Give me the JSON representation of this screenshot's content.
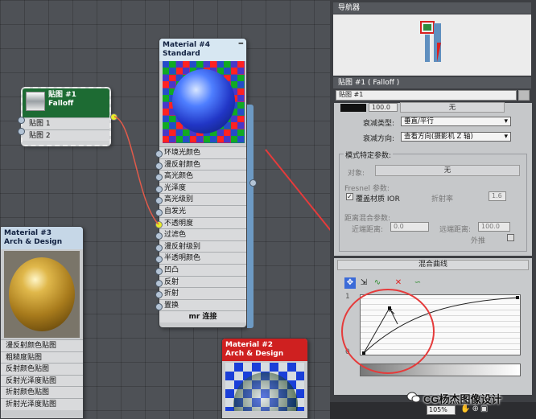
{
  "falloff_node": {
    "title_line1": "贴图 #1",
    "title_line2": "Falloff",
    "slots": [
      "贴图 1",
      "贴图 2"
    ]
  },
  "material4": {
    "title_line1": "Material #4",
    "title_line2": "Standard",
    "slots": [
      "环境光颜色",
      "漫反射颜色",
      "高光颜色",
      "光泽度",
      "高光级别",
      "自发光",
      "不透明度",
      "过滤色",
      "漫反射级别",
      "半透明颜色",
      "凹凸",
      "反射",
      "折射",
      "置换"
    ],
    "footer": "mr 连接"
  },
  "material3": {
    "title_line1": "Material #3",
    "title_line2": "Arch & Design",
    "slots": [
      "漫反射颜色贴图",
      "粗糙度贴图",
      "反射颜色贴图",
      "反射光泽度贴图",
      "折射颜色贴图",
      "折射光泽度贴图"
    ]
  },
  "material2": {
    "title_line1": "Material #2",
    "title_line2": "Arch & Design"
  },
  "navigator": {
    "title": "导航器"
  },
  "props": {
    "title": "贴图 #1 ( Falloff )",
    "name_value": "贴图 #1",
    "top_value": "100.0",
    "top_button": "无",
    "falloff_type_label": "衰减类型:",
    "falloff_type_value": "垂直/平行",
    "falloff_dir_label": "衰减方向:",
    "falloff_dir_value": "查看方向(摄影机 Z 轴)",
    "mode_group_label": "模式特定参数:",
    "object_label": "对象:",
    "object_button": "无",
    "fresnel_label": "Fresnel 参数:",
    "override_ior_label": "覆盖材质 IOR",
    "refraction_label": "折射率",
    "refraction_value": "1.6",
    "distance_label": "距离混合参数:",
    "near_label": "近端距离:",
    "near_value": "0.0",
    "far_label": "远端距离:",
    "far_value": "100.0",
    "extrapolate_label": "外推"
  },
  "curve": {
    "title": "混合曲线",
    "axis_top": "1",
    "axis_bottom": "0"
  },
  "status": {
    "zoom": "105%"
  },
  "watermark": "CG杨杰图像设计",
  "colors": {
    "falloff_header": "#1d6b33",
    "material2_header": "#cf2020",
    "annotation": "#e53b3b",
    "link_wire": "#e05a4a"
  }
}
